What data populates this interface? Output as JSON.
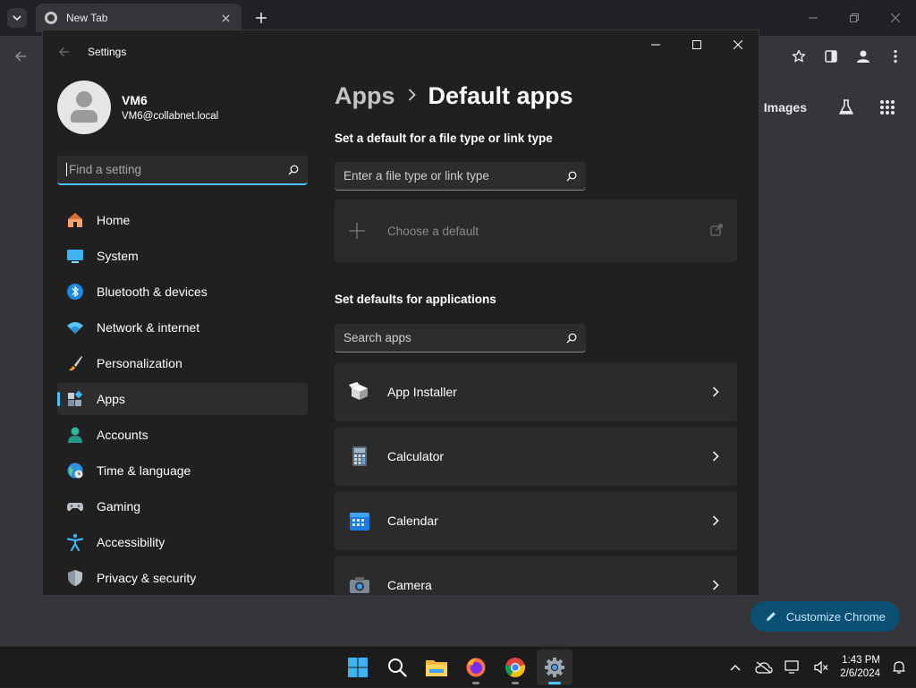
{
  "chrome": {
    "tab_title": "New Tab",
    "ntp_images_link": "Images",
    "customize_label": "Customize Chrome"
  },
  "settings": {
    "window_title": "Settings",
    "profile": {
      "name": "VM6",
      "email": "VM6@collabnet.local"
    },
    "find_placeholder": "Find a setting",
    "nav": [
      {
        "label": "Home",
        "icon": "home-icon"
      },
      {
        "label": "System",
        "icon": "system-icon"
      },
      {
        "label": "Bluetooth & devices",
        "icon": "bluetooth-icon"
      },
      {
        "label": "Network & internet",
        "icon": "network-icon"
      },
      {
        "label": "Personalization",
        "icon": "brush-icon"
      },
      {
        "label": "Apps",
        "icon": "apps-icon",
        "selected": true
      },
      {
        "label": "Accounts",
        "icon": "accounts-icon"
      },
      {
        "label": "Time & language",
        "icon": "globe-icon"
      },
      {
        "label": "Gaming",
        "icon": "gamepad-icon"
      },
      {
        "label": "Accessibility",
        "icon": "accessibility-icon"
      },
      {
        "label": "Privacy & security",
        "icon": "shield-icon"
      }
    ],
    "breadcrumb": {
      "parent": "Apps",
      "current": "Default apps"
    },
    "file_type_section": {
      "heading": "Set a default for a file type or link type",
      "search_placeholder": "Enter a file type or link type",
      "choose_default_label": "Choose a default"
    },
    "apps_section": {
      "heading": "Set defaults for applications",
      "search_placeholder": "Search apps",
      "apps": [
        {
          "name": "App Installer",
          "icon": "package-icon"
        },
        {
          "name": "Calculator",
          "icon": "calculator-icon"
        },
        {
          "name": "Calendar",
          "icon": "calendar-icon"
        },
        {
          "name": "Camera",
          "icon": "camera-icon"
        }
      ]
    }
  },
  "taskbar": {
    "time": "1:43 PM",
    "date": "2/6/2024"
  },
  "colors": {
    "accent": "#4cc2ff",
    "window_bg": "#202020",
    "card_bg": "#2b2b2b",
    "chrome_bg": "#35363a"
  }
}
